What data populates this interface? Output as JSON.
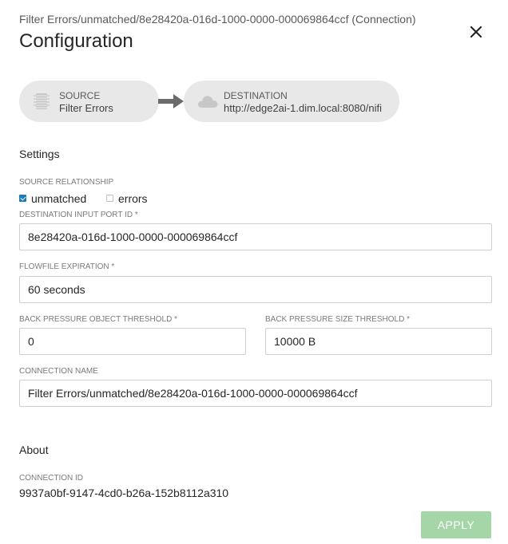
{
  "header": {
    "subtitle": "Filter Errors/unmatched/8e28420a-016d-1000-0000-000069864ccf (Connection)",
    "title": "Configuration"
  },
  "flow": {
    "source": {
      "kind": "SOURCE",
      "name": "Filter Errors",
      "icon": "processor-chip-icon"
    },
    "destination": {
      "kind": "DESTINATION",
      "name": "http://edge2ai-1.dim.local:8080/nifi",
      "icon": "cloud-icon"
    }
  },
  "settings": {
    "heading": "Settings",
    "source_relationship": {
      "label": "SOURCE RELATIONSHIP",
      "options": [
        {
          "label": "unmatched",
          "checked": true
        },
        {
          "label": "errors",
          "checked": false
        }
      ]
    },
    "destination_input_port_id": {
      "label": "DESTINATION INPUT PORT ID *",
      "value": "8e28420a-016d-1000-0000-000069864ccf"
    },
    "flowfile_expiration": {
      "label": "FLOWFILE EXPIRATION *",
      "value": "60 seconds"
    },
    "back_pressure_object_threshold": {
      "label": "BACK PRESSURE OBJECT THRESHOLD *",
      "value": "0"
    },
    "back_pressure_size_threshold": {
      "label": "BACK PRESSURE SIZE THRESHOLD *",
      "value": "10000 B"
    },
    "connection_name": {
      "label": "CONNECTION NAME",
      "value": "Filter Errors/unmatched/8e28420a-016d-1000-0000-000069864ccf"
    }
  },
  "about": {
    "heading": "About",
    "connection_id_label": "CONNECTION ID",
    "connection_id": "9937a0bf-9147-4cd0-b26a-152b8112a310"
  },
  "actions": {
    "apply_label": "APPLY"
  },
  "colors": {
    "pill_background": "#e8e8e8",
    "checkbox_checked": "#1e7ab8",
    "apply_disabled": "#a5d6a7",
    "input_border": "#cfcfcf"
  }
}
